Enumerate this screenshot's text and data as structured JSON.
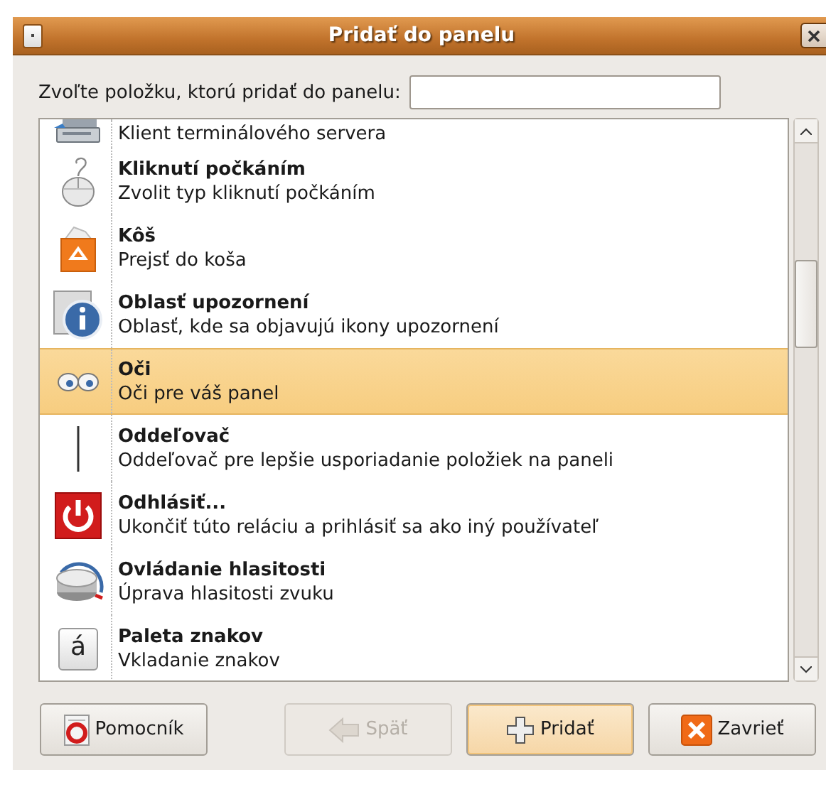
{
  "window": {
    "title": "Pridať do panelu"
  },
  "search": {
    "label": "Zvoľte položku, ktorú pridať do panelu:"
  },
  "items": [
    {
      "kind": "terminal",
      "description": "Klient terminálového servera",
      "selected": false
    },
    {
      "kind": "mouse",
      "title": "Kliknutí počkáním",
      "description": "Zvolit typ kliknutí počkáním",
      "selected": false
    },
    {
      "kind": "trash",
      "title": "Kôš",
      "description": "Prejsť do koša",
      "selected": false
    },
    {
      "kind": "info",
      "title": "Oblasť upozornení",
      "description": "Oblasť, kde sa objavujú ikony upozornení",
      "selected": false
    },
    {
      "kind": "eyes",
      "title": "Oči",
      "description": "Oči pre váš panel",
      "selected": true
    },
    {
      "kind": "separator",
      "title": "Oddeľovač",
      "description": "Oddeľovač pre lepšie usporiadanie položiek na paneli",
      "selected": false
    },
    {
      "kind": "power",
      "title": "Odhlásiť...",
      "description": "Ukončiť túto reláciu a prihlásiť sa ako iný používateľ",
      "selected": false
    },
    {
      "kind": "volume",
      "title": "Ovládanie hlasitosti",
      "description": "Úprava hlasitosti zvuku",
      "selected": false
    },
    {
      "kind": "character",
      "icon_text": "á",
      "title": "Paleta znakov",
      "description": "Vkladanie znakov",
      "selected": false
    }
  ],
  "buttons": [
    {
      "kind": "help",
      "label": "Pomocník",
      "disabled": false,
      "highlighted": false
    },
    {
      "kind": "back",
      "label": "Späť",
      "disabled": true,
      "highlighted": false
    },
    {
      "kind": "add",
      "label": "Pridať",
      "disabled": false,
      "highlighted": true
    },
    {
      "kind": "close",
      "label": "Zavrieť",
      "disabled": false,
      "highlighted": false
    }
  ]
}
